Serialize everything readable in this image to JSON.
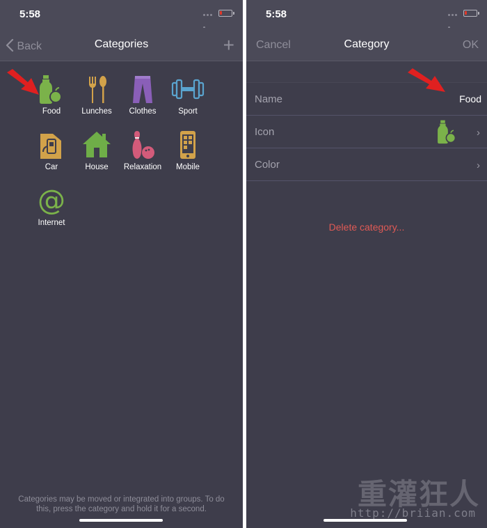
{
  "left_screen": {
    "status": {
      "time": "5:58"
    },
    "nav": {
      "back_label": "Back",
      "title": "Categories",
      "add_label": "+"
    },
    "categories": [
      {
        "label": "Food",
        "icon": "food-icon"
      },
      {
        "label": "Lunches",
        "icon": "fork-spoon-icon"
      },
      {
        "label": "Clothes",
        "icon": "pants-icon"
      },
      {
        "label": "Sport",
        "icon": "dumbbell-icon"
      },
      {
        "label": "Car",
        "icon": "fuel-canister-icon"
      },
      {
        "label": "House",
        "icon": "house-icon"
      },
      {
        "label": "Relaxation",
        "icon": "bowling-icon"
      },
      {
        "label": "Mobile",
        "icon": "mobile-phone-icon"
      },
      {
        "label": "Internet",
        "icon": "at-sign-icon"
      }
    ],
    "footer_note": "Categories may be moved or integrated into groups. To do this, press the category and hold it for a second."
  },
  "right_screen": {
    "status": {
      "time": "5:58"
    },
    "nav": {
      "cancel_label": "Cancel",
      "title": "Category",
      "ok_label": "OK"
    },
    "rows": {
      "name_label": "Name",
      "name_value": "Food",
      "icon_label": "Icon",
      "color_label": "Color"
    },
    "delete_label": "Delete category..."
  },
  "watermark": {
    "text": "重灌狂人",
    "url": "http://briian.com"
  },
  "colors": {
    "background": "#3e3d4b",
    "nav_bar": "#4b4a58",
    "food": "#7bb24a",
    "lunches": "#d2a24a",
    "clothes": "#8a5fb8",
    "sport": "#5aa4cf",
    "car": "#d2a24a",
    "house": "#6fae48",
    "relaxation": "#d35b7a",
    "mobile": "#d2a24a",
    "internet": "#7bb24a",
    "delete": "#e05a55",
    "arrow": "#e02020"
  }
}
